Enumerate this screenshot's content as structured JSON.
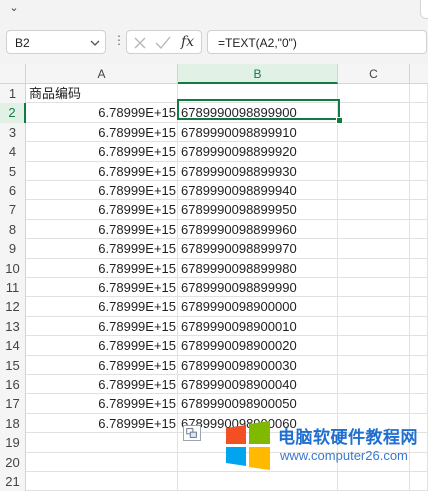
{
  "ribbon": {
    "collapse_glyph": "⌄"
  },
  "formula_bar": {
    "name_box": "B2",
    "function_icon": "fx",
    "formula": "=TEXT(A2,\"0\")"
  },
  "columns": [
    "A",
    "B",
    "C"
  ],
  "rows": [
    {
      "n": "1",
      "a": "商品编码",
      "b": ""
    },
    {
      "n": "2",
      "a": "6.78999E+15",
      "b": "6789990098899900"
    },
    {
      "n": "3",
      "a": "6.78999E+15",
      "b": "6789990098899910"
    },
    {
      "n": "4",
      "a": "6.78999E+15",
      "b": "6789990098899920"
    },
    {
      "n": "5",
      "a": "6.78999E+15",
      "b": "6789990098899930"
    },
    {
      "n": "6",
      "a": "6.78999E+15",
      "b": "6789990098899940"
    },
    {
      "n": "7",
      "a": "6.78999E+15",
      "b": "6789990098899950"
    },
    {
      "n": "8",
      "a": "6.78999E+15",
      "b": "6789990098899960"
    },
    {
      "n": "9",
      "a": "6.78999E+15",
      "b": "6789990098899970"
    },
    {
      "n": "10",
      "a": "6.78999E+15",
      "b": "6789990098899980"
    },
    {
      "n": "11",
      "a": "6.78999E+15",
      "b": "6789990098899990"
    },
    {
      "n": "12",
      "a": "6.78999E+15",
      "b": "6789990098900000"
    },
    {
      "n": "13",
      "a": "6.78999E+15",
      "b": "6789990098900010"
    },
    {
      "n": "14",
      "a": "6.78999E+15",
      "b": "6789990098900020"
    },
    {
      "n": "15",
      "a": "6.78999E+15",
      "b": "6789990098900030"
    },
    {
      "n": "16",
      "a": "6.78999E+15",
      "b": "6789990098900040"
    },
    {
      "n": "17",
      "a": "6.78999E+15",
      "b": "6789990098900050"
    },
    {
      "n": "18",
      "a": "6.78999E+15",
      "b": "6789990098900060"
    },
    {
      "n": "19",
      "a": "",
      "b": ""
    },
    {
      "n": "20",
      "a": "",
      "b": ""
    },
    {
      "n": "21",
      "a": "",
      "b": ""
    }
  ],
  "watermark": {
    "title": "电脑软硬件教程网",
    "url": "www.computer26.com"
  },
  "colors": {
    "accent": "#107c41",
    "watermark_blue": "#1f6fd1"
  },
  "icons": [
    "chevron-down-icon",
    "cancel-icon",
    "enter-check-icon",
    "function-icon",
    "paste-options-icon",
    "windows-logo"
  ]
}
